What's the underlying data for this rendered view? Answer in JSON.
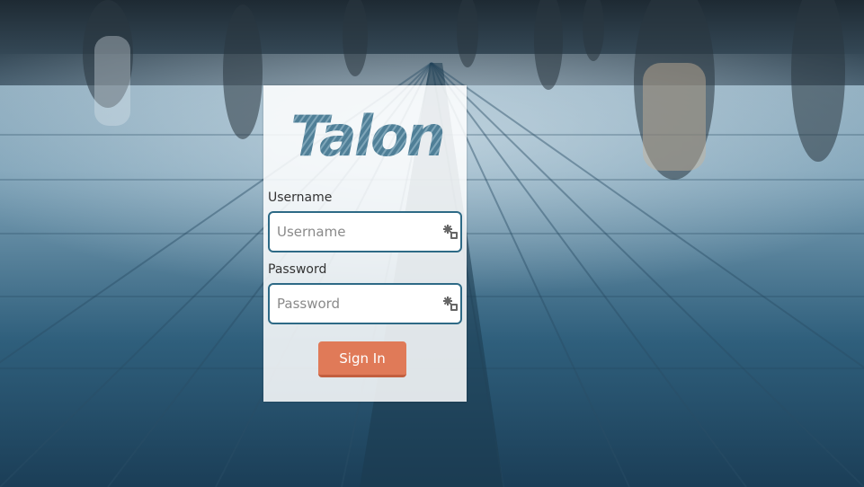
{
  "brand": {
    "logo_text": "Talon",
    "logo_color": "#4f7f97"
  },
  "login": {
    "username_label": "Username",
    "username_placeholder": "Username",
    "username_value": "",
    "password_label": "Password",
    "password_placeholder": "Password",
    "password_value": "",
    "signin_label": "Sign In",
    "field_icon": "keychain-autofill-icon"
  },
  "colors": {
    "accent_button": "#e07a58",
    "input_border": "#2e6a86",
    "background_tone": "#5f8fa8"
  }
}
